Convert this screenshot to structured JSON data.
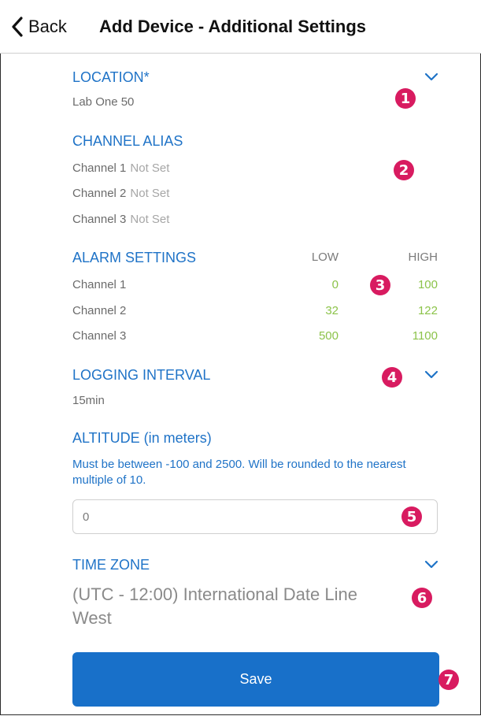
{
  "header": {
    "back_label": "Back",
    "title": "Add Device - Additional Settings"
  },
  "location": {
    "title": "LOCATION*",
    "value": "Lab One 50",
    "badge": "1"
  },
  "channel_alias": {
    "title": "CHANNEL ALIAS",
    "badge": "2",
    "items": [
      {
        "label": "Channel 1",
        "value": "Not Set"
      },
      {
        "label": "Channel 2",
        "value": "Not Set"
      },
      {
        "label": "Channel 3",
        "value": "Not Set"
      }
    ]
  },
  "alarm_settings": {
    "title": "ALARM SETTINGS",
    "low_header": "LOW",
    "high_header": "HIGH",
    "badge": "3",
    "rows": [
      {
        "label": "Channel 1",
        "low": "0",
        "high": "100"
      },
      {
        "label": "Channel 2",
        "low": "32",
        "high": "122"
      },
      {
        "label": "Channel 3",
        "low": "500",
        "high": "1100"
      }
    ]
  },
  "logging_interval": {
    "title": "LOGGING INTERVAL",
    "value": "15min",
    "badge": "4"
  },
  "altitude": {
    "title": "ALTITUDE (in meters)",
    "hint": "Must be between -100 and 2500. Will be rounded to the nearest multiple of 10.",
    "value": "0",
    "badge": "5"
  },
  "time_zone": {
    "title": "TIME ZONE",
    "value": "(UTC - 12:00) International Date Line West",
    "badge": "6"
  },
  "save": {
    "label": "Save",
    "badge": "7"
  },
  "colors": {
    "accent_blue": "#1f73c7",
    "value_green": "#8cc34a",
    "badge_magenta": "#d81b60",
    "save_blue": "#1870c9"
  }
}
